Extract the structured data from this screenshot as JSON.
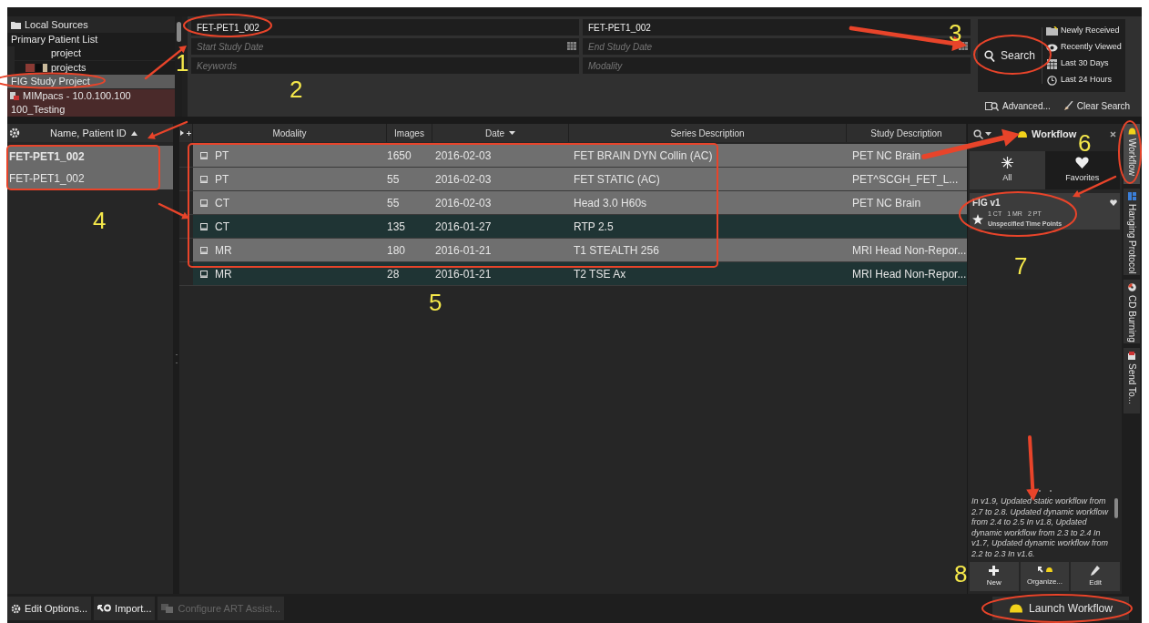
{
  "sources": [
    {
      "label": "Local Sources",
      "kind": "group",
      "selected": false
    },
    {
      "label": "Primary Patient List",
      "kind": "item",
      "selected": false
    },
    {
      "label": "project",
      "kind": "sub",
      "selected": false
    },
    {
      "label": "projects",
      "kind": "swatch",
      "selected": false
    },
    {
      "label": "FIG Study Project",
      "kind": "item",
      "selected": true
    },
    {
      "label": "MIMpacs - 10.0.100.100",
      "kind": "remote",
      "selected": false
    },
    {
      "label": "100_Testing",
      "kind": "remote-item",
      "selected": false
    }
  ],
  "search_fields": [
    {
      "value": "FET-PET1_002",
      "calendar": false
    },
    {
      "value": "FET-PET1_002",
      "calendar": false
    },
    {
      "placeholder": "Start Study Date",
      "calendar": true
    },
    {
      "placeholder": "End Study Date",
      "calendar": true
    },
    {
      "placeholder": "Keywords",
      "calendar": false
    },
    {
      "placeholder": "Modality",
      "calendar": false
    }
  ],
  "search_button": "Search",
  "quick_filters": [
    "Newly Received",
    "Recently Viewed",
    "Last 30 Days",
    "Last 24 Hours"
  ],
  "search_links": [
    "Advanced...",
    "Clear Search"
  ],
  "patient_list": {
    "header": "Name, Patient ID",
    "patients": [
      {
        "name": "FET-PET1_002",
        "patient_id": "FET-PET1_002",
        "selected": true
      }
    ]
  },
  "series_table": {
    "columns": [
      "Modality",
      "Images",
      "Date",
      "Series Description",
      "Study Description"
    ],
    "rows": [
      {
        "modality": "PT",
        "images": "1650",
        "date": "2016-02-03",
        "series": "FET BRAIN DYN Collin (AC)",
        "study": "PET NC Brain",
        "selected": true
      },
      {
        "modality": "PT",
        "images": "55",
        "date": "2016-02-03",
        "series": "FET STATIC (AC)",
        "study": "PET^SCGH_FET_L...",
        "selected": true
      },
      {
        "modality": "CT",
        "images": "55",
        "date": "2016-02-03",
        "series": "Head  3.0  H60s",
        "study": "PET NC Brain",
        "selected": true
      },
      {
        "modality": "CT",
        "images": "135",
        "date": "2016-01-27",
        "series": "RTP 2.5",
        "study": "",
        "selected": false
      },
      {
        "modality": "MR",
        "images": "180",
        "date": "2016-01-21",
        "series": "T1 STEALTH 256",
        "study": "MRI Head Non-Repor...",
        "selected": true
      },
      {
        "modality": "MR",
        "images": "28",
        "date": "2016-01-21",
        "series": "T2 TSE Ax",
        "study": "MRI Head Non-Repor...",
        "selected": false
      }
    ]
  },
  "workflow_panel": {
    "title": "Workflow",
    "tabs": [
      {
        "label": "All",
        "selected": true
      },
      {
        "label": "Favorites",
        "selected": false
      }
    ],
    "workflows": [
      {
        "name": "FIG v1",
        "modalities": [
          "1 CT",
          "1 MR",
          "2 PT"
        ],
        "time_points": "Unspecified Time Points",
        "favorite": true
      }
    ],
    "description": "In v1.9, Updated static workflow from 2.7 to 2.8. Updated dynamic workflow from 2.4 to 2.5 In v1.8, Updated dynamic workflow from 2.3 to 2.4 In v1.7, Updated dynamic workflow from 2.2 to 2.3 In v1.6.",
    "buttons": [
      "New",
      "Organize...",
      "Edit"
    ]
  },
  "side_tabs": [
    {
      "label": "Workflow",
      "selected": true
    },
    {
      "label": "Hanging Protocol",
      "selected": false
    },
    {
      "label": "CD Burning",
      "selected": false
    },
    {
      "label": "Send To...",
      "selected": false
    }
  ],
  "bottom_buttons": [
    {
      "label": "Edit Options...",
      "disabled": false
    },
    {
      "label": "Import...",
      "disabled": false
    },
    {
      "label": "Configure ART Assist...",
      "disabled": true
    }
  ],
  "launch_button": "Launch Workflow",
  "annotations": [
    "1",
    "2",
    "3",
    "4",
    "5",
    "6",
    "7",
    "8"
  ]
}
